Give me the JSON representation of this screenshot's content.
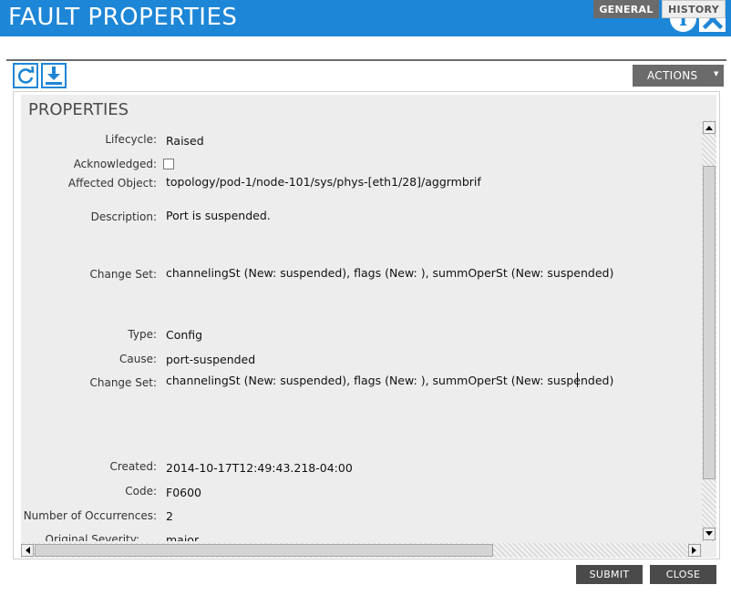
{
  "window": {
    "title": "FAULT PROPERTIES",
    "info_label": "i"
  },
  "tabs": [
    {
      "label": "GENERAL",
      "active": true
    },
    {
      "label": "HISTORY",
      "active": false
    }
  ],
  "toolbar": {
    "refresh_icon": "refresh-icon",
    "download_icon": "download-icon",
    "actions_label": "ACTIONS",
    "actions_caret": "▼"
  },
  "section": {
    "title": "PROPERTIES"
  },
  "properties": {
    "lifecycle": {
      "label": "Lifecycle:",
      "value": "Raised"
    },
    "acknowledged": {
      "label": "Acknowledged:",
      "checked": false
    },
    "affected_object": {
      "label": "Affected Object:",
      "value": "topology/pod-1/node-101/sys/phys-[eth1/28]/aggrmbrif"
    },
    "description": {
      "label": "Description:",
      "value": "Port is suspended."
    },
    "change_set_1": {
      "label": "Change Set:",
      "value": "channelingSt (New: suspended), flags (New: ), summOperSt (New: suspended)"
    },
    "type": {
      "label": "Type:",
      "value": "Config"
    },
    "cause": {
      "label": "Cause:",
      "value": "port-suspended"
    },
    "change_set_2": {
      "label": "Change Set:",
      "value": "channelingSt (New: suspended), flags (New: ), summOperSt (New: suspended)"
    },
    "created": {
      "label": "Created:",
      "value": "2014-10-17T12:49:43.218-04:00"
    },
    "code": {
      "label": "Code:",
      "value": "F0600"
    },
    "occurrences": {
      "label": "Number of Occurrences:",
      "value": "2"
    },
    "original_severity": {
      "label": "Original Severity:",
      "value": "major"
    }
  },
  "footer": {
    "submit_label": "SUBMIT",
    "close_label": "CLOSE"
  },
  "colors": {
    "accent": "#1e86d6",
    "tab_active": "#6b6b6b",
    "panel_bg": "#ededed",
    "button_dark": "#4a4a4a"
  }
}
